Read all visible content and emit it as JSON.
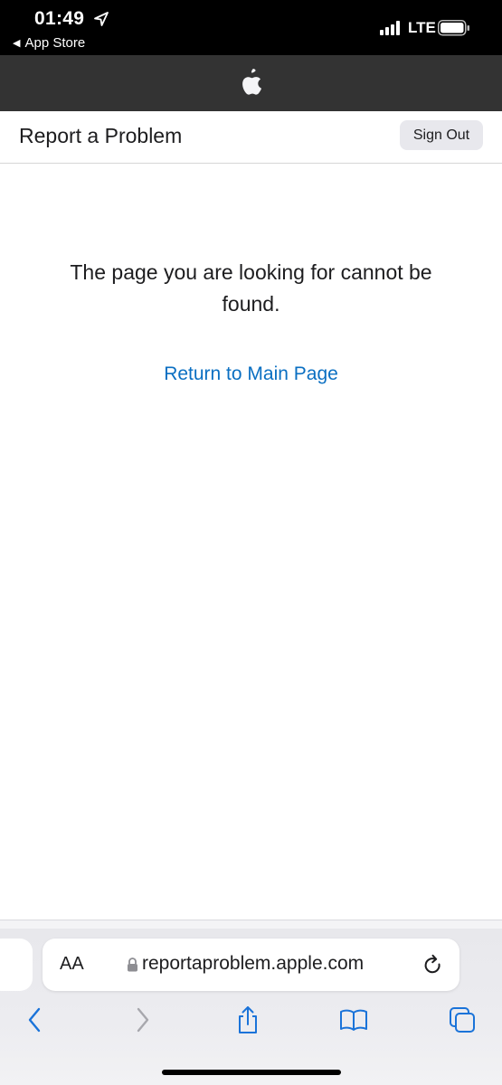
{
  "status_bar": {
    "time": "01:49",
    "back_app": "App Store",
    "carrier": "LTE"
  },
  "sub_header": {
    "title": "Report a Problem",
    "sign_out": "Sign Out"
  },
  "main": {
    "message": "The page you are looking for cannot be found.",
    "return_link": "Return to Main Page"
  },
  "address_bar": {
    "text_size_label": "AA",
    "url": "reportaproblem.apple.com"
  },
  "colors": {
    "link": "#0a6fc2",
    "toolbar_icon": "#1a73d9",
    "nav_bg": "#333333"
  },
  "icons": [
    "location-arrow-icon",
    "signal-icon",
    "battery-icon",
    "apple-logo-icon",
    "lock-icon",
    "reload-icon",
    "back-arrow-icon",
    "forward-arrow-icon",
    "share-icon",
    "bookmarks-icon",
    "tabs-icon"
  ]
}
